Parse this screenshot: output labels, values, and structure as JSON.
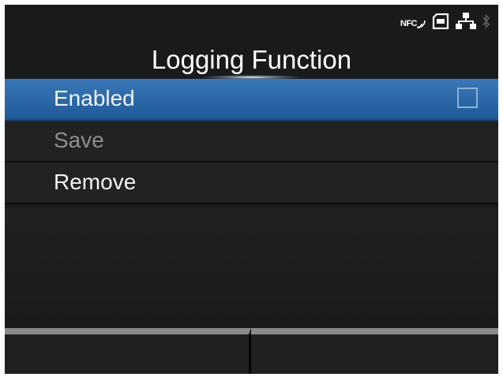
{
  "status_bar": {
    "nfc_label": "NFC",
    "icons": [
      "nfc-icon",
      "sd-card-icon",
      "network-icon",
      "bluetooth-icon"
    ]
  },
  "header": {
    "title": "Logging Function"
  },
  "menu": {
    "items": [
      {
        "label": "Enabled",
        "selected": true,
        "enabled": true,
        "checked": false
      },
      {
        "label": "Save",
        "selected": false,
        "enabled": false
      },
      {
        "label": "Remove",
        "selected": false,
        "enabled": true
      }
    ]
  },
  "softkeys": {
    "left_label": "",
    "right_label": ""
  },
  "colors": {
    "background": "#191b1b",
    "selection": "#2d6aa9",
    "text": "#f2f2f2",
    "disabled_text": "#8e8e8e",
    "softkey_bar": "#8a8a8a"
  }
}
